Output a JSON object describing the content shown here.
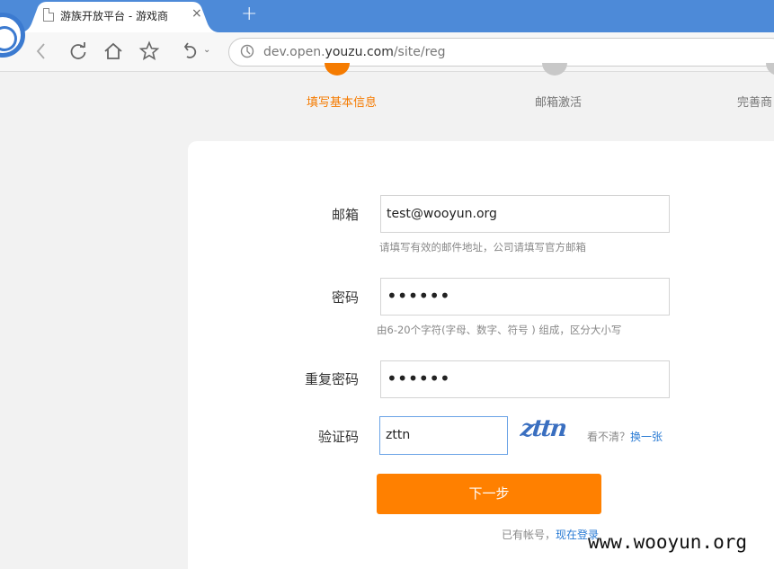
{
  "browser": {
    "tab_title": "游族开放平台 - 游戏商",
    "tab_close": "×",
    "new_tab": "+",
    "address_prefix": "dev.open.",
    "address_domain": "youzu.com",
    "address_suffix": "/site/reg"
  },
  "steps": [
    {
      "label": "填写基本信息",
      "active": true
    },
    {
      "label": "邮箱激活",
      "active": false
    },
    {
      "label": "完善商",
      "active": false
    }
  ],
  "form": {
    "email_label": "邮箱",
    "email_value": "test@wooyun.org",
    "email_hint": "请填写有效的邮件地址，公司请填写官方邮箱",
    "password_label": "密码",
    "password_value": "••••••",
    "password_hint": "由6-20个字符(字母、数字、符号 ) 组成，区分大小写",
    "confirm_label": "重复密码",
    "confirm_value": "••••••",
    "captcha_label": "验证码",
    "captcha_value": "zttn",
    "captcha_image_text": "zttn",
    "captcha_help_text": "看不清？",
    "captcha_refresh_link": "换一张",
    "submit_label": "下一步",
    "login_prompt": "已有帐号，",
    "login_link": "现在登录"
  },
  "watermark": "www.wooyun.org",
  "colors": {
    "accent": "#ff8000",
    "link": "#2a7bd4",
    "tabbar": "#4d8ad8"
  }
}
